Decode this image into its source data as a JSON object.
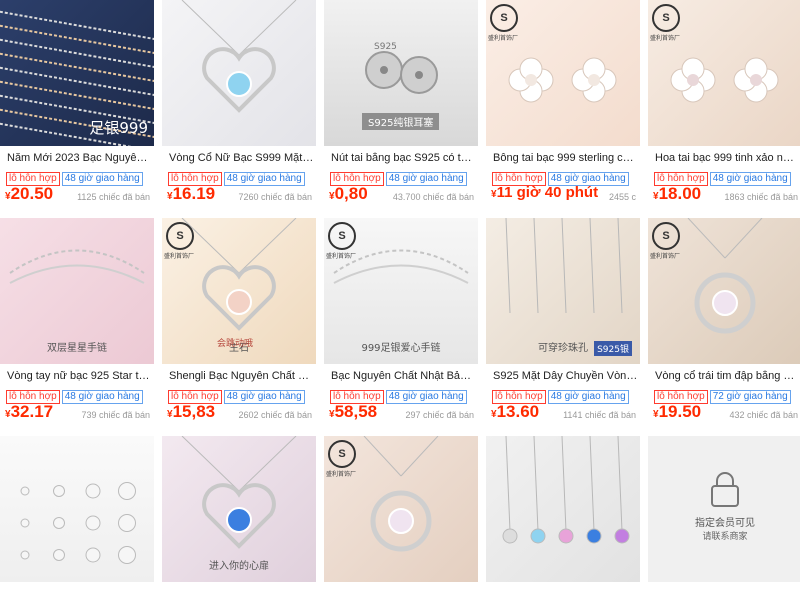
{
  "colors": {
    "price": "#ff2a00",
    "tag_red": "#ff3b2f",
    "tag_blue": "#2a7ae2"
  },
  "tags": {
    "mixed": "lô hỗn hợp",
    "ship48": "48 giờ giao hàng",
    "ship72": "72 giờ giao hàng"
  },
  "currency": "¥",
  "products": [
    {
      "title": "Năm Mới 2023 Bạc Nguyên Ch...",
      "price": "20.50",
      "sold": "1125 chiếc đã bán",
      "ship": "48 giờ giao hàng",
      "image": "chains-on-blue",
      "overlay": "足银999"
    },
    {
      "title": "Vòng Cổ Nữ Bạc S999 Mặt Dây...",
      "price": "16.19",
      "sold": "7260 chiếc đã bán",
      "ship": "48 giờ giao hàng",
      "image": "heart-pendants"
    },
    {
      "title": "Nút tai bằng bạc S925 có thể t...",
      "price": "0,80",
      "sold": "43.700 chiếc đã bán",
      "ship": "48 giờ giao hàng",
      "image": "ear-backs",
      "overlay": "S925纯银耳塞",
      "overlay2": "S925"
    },
    {
      "title": "Bông tai bạc 999 sterling chân ...",
      "price": "11 giờ 40 phút",
      "sold": "2455 c",
      "ship": "48 giờ giao hàng",
      "image": "clover-earrings",
      "brand": "S",
      "brand_text": "盛利首饰厂"
    },
    {
      "title": "Hoa tai bạc 999 tinh xảo nữ ki...",
      "price": "18.00",
      "sold": "1863 chiếc đã bán",
      "ship": "48 giờ giao hàng",
      "image": "flower-earrings",
      "brand": "S",
      "brand_text": "盛利首饰厂"
    },
    {
      "title": "Vòng tay nữ bạc 925 Star thiết...",
      "price": "32.17",
      "sold": "739 chiếc đã bán",
      "ship": "48 giờ giao hàng",
      "image": "bracelet-pink",
      "overlay": "双层星星手链"
    },
    {
      "title": "Shengli Bạc Nguyên Chất Bạc ...",
      "price": "15,83",
      "sold": "2602 chiếc đã bán",
      "ship": "48 giờ giao hàng",
      "image": "heart-pendant-gold",
      "brand": "S",
      "brand_text": "盛利首饰厂",
      "overlay": "主石",
      "overlay2": "会跳动哦"
    },
    {
      "title": "Bạc Nguyên Chất Nhật Bản Và ...",
      "price": "58,58",
      "sold": "297 chiếc đã bán",
      "ship": "48 giờ giao hàng",
      "image": "heart-bracelet",
      "brand": "S",
      "brand_text": "盛利首饰厂",
      "overlay": "999足银爱心手链"
    },
    {
      "title": "S925 Mặt Dây Chuyền Vòng Cổ...",
      "price": "13.60",
      "sold": "1141 chiếc đã bán",
      "ship": "48 giờ giao hàng",
      "image": "chains-hanging",
      "overlay": "可穿珍珠孔",
      "overlay2": "S925银"
    },
    {
      "title": "Vòng cổ trái tim đập bằng bạc ...",
      "price": "19.50",
      "sold": "432 chiếc đã bán",
      "ship": "72 giờ giao hàng",
      "image": "swirl-pendant",
      "brand": "S",
      "brand_text": "盛利首饰厂"
    },
    {
      "title": "",
      "price": "",
      "sold": "",
      "ship": "",
      "image": "stud-sizes"
    },
    {
      "title": "",
      "price": "",
      "sold": "",
      "ship": "",
      "image": "blue-heart-pendant",
      "overlay": "进入你的心扉"
    },
    {
      "title": "",
      "price": "",
      "sold": "",
      "ship": "",
      "image": "drop-pendant",
      "brand": "S",
      "brand_text": "盛利首饰厂"
    },
    {
      "title": "",
      "price": "",
      "sold": "",
      "ship": "",
      "image": "five-pendants"
    },
    {
      "title": "",
      "price": "",
      "sold": "",
      "ship": "",
      "image": "locked-placeholder",
      "overlay": "指定会员可见",
      "overlay2": "请联系商家"
    }
  ]
}
